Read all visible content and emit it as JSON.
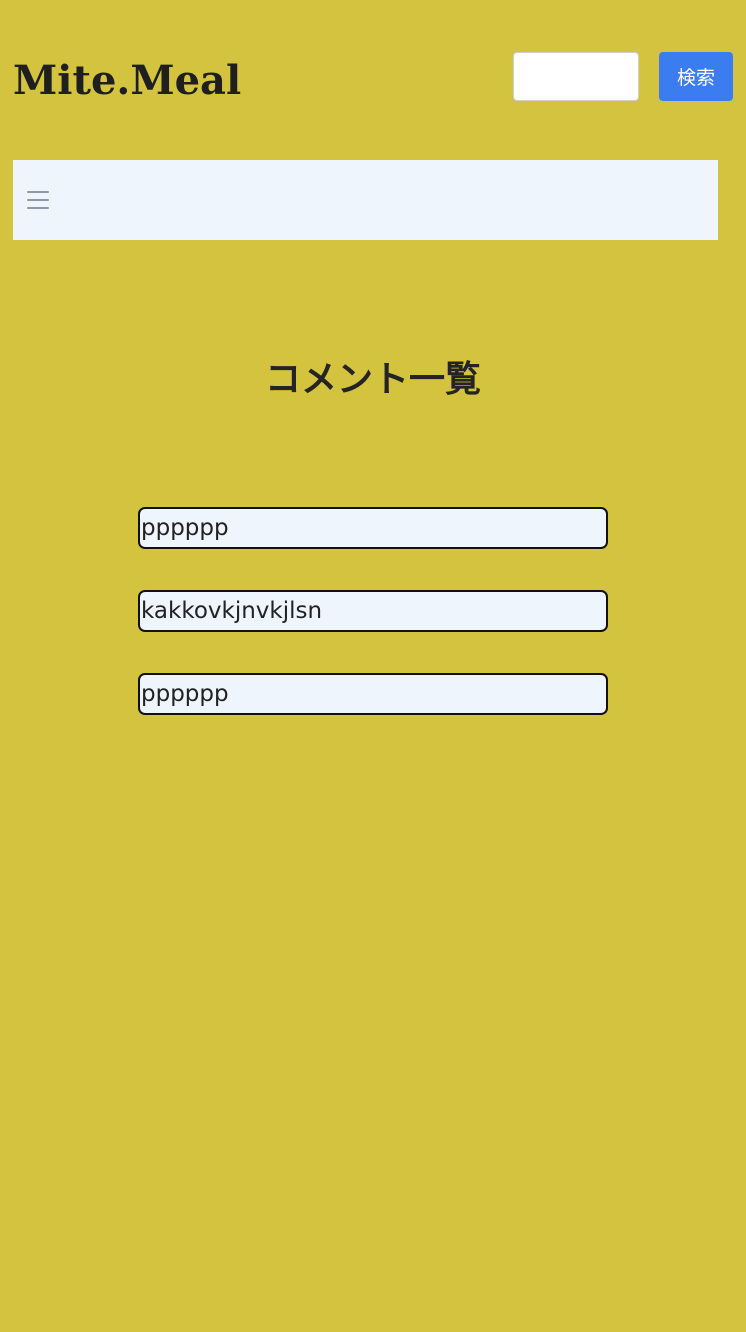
{
  "header": {
    "logo_text": "Mite.Meal",
    "search": {
      "value": "",
      "placeholder": ""
    },
    "search_button_label": "検索"
  },
  "navbar": {
    "menu_icon": "hamburger-menu-icon"
  },
  "main": {
    "title": "コメント一覧",
    "comments": [
      {
        "text": "pppppp"
      },
      {
        "text": "kakkovkjnvkjlsn"
      },
      {
        "text": "pppppp"
      }
    ]
  },
  "colors": {
    "background": "#d4c33f",
    "navbar": "#eff5fd",
    "button": "#3b7cf0",
    "comment_bg": "#eff5fd",
    "comment_border": "#111111"
  }
}
